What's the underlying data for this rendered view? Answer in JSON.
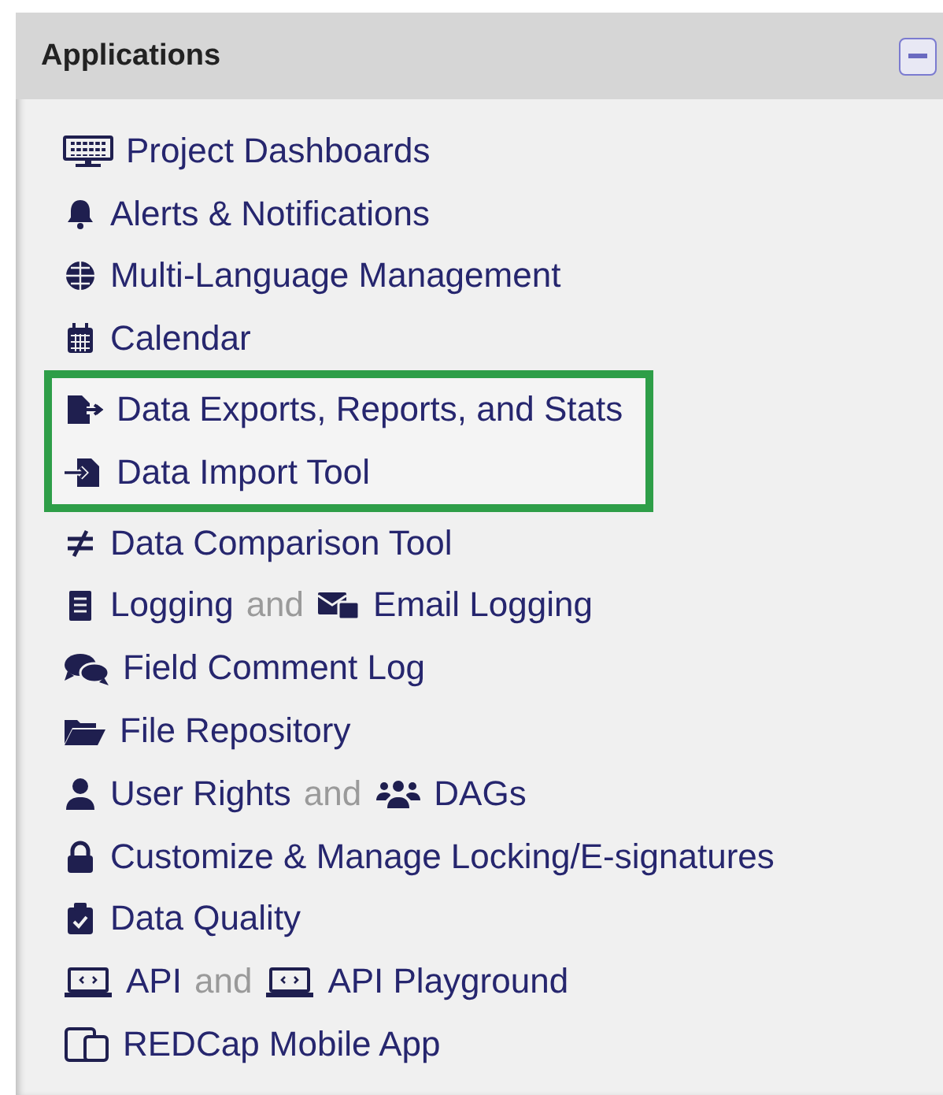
{
  "panel": {
    "title": "Applications",
    "expanded": true
  },
  "sections": [
    {
      "highlighted": false,
      "items": [
        {
          "links": [
            {
              "label": "Project Dashboards"
            }
          ]
        },
        {
          "links": [
            {
              "label": "Alerts & Notifications"
            }
          ]
        },
        {
          "links": [
            {
              "label": "Multi-Language Management"
            }
          ]
        },
        {
          "links": [
            {
              "label": "Calendar"
            }
          ]
        }
      ]
    },
    {
      "highlighted": true,
      "items": [
        {
          "links": [
            {
              "label": "Data Exports, Reports, and Stats"
            }
          ]
        },
        {
          "links": [
            {
              "label": "Data Import Tool"
            }
          ]
        }
      ]
    },
    {
      "highlighted": false,
      "items": [
        {
          "links": [
            {
              "label": "Data Comparison Tool"
            }
          ]
        },
        {
          "links": [
            {
              "label": "Logging"
            },
            {
              "label": "Email Logging"
            }
          ],
          "joiner": "and"
        },
        {
          "links": [
            {
              "label": "Field Comment Log"
            }
          ]
        },
        {
          "links": [
            {
              "label": "File Repository"
            }
          ]
        },
        {
          "links": [
            {
              "label": "User Rights"
            },
            {
              "label": "DAGs"
            }
          ],
          "joiner": "and"
        },
        {
          "links": [
            {
              "label": "Customize & Manage Locking/E-signatures"
            }
          ]
        },
        {
          "links": [
            {
              "label": "Data Quality"
            }
          ]
        },
        {
          "links": [
            {
              "label": "API"
            },
            {
              "label": "API Playground"
            }
          ],
          "joiner": "and"
        },
        {
          "links": [
            {
              "label": "REDCap Mobile App"
            }
          ]
        }
      ]
    }
  ]
}
